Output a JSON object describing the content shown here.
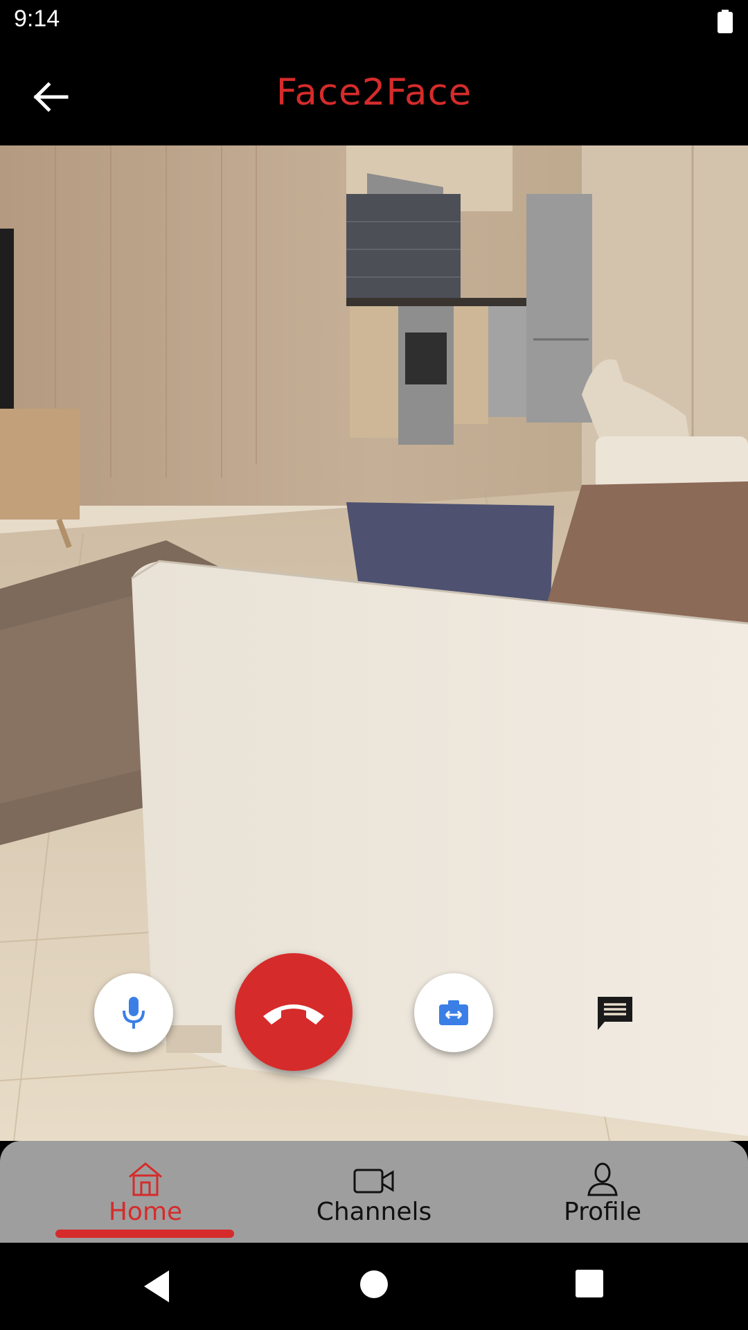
{
  "status_bar": {
    "time": "9:14"
  },
  "app_bar": {
    "title": "Face2Face"
  },
  "call_controls": {
    "mic": "mic-icon",
    "end_call": "call-end-icon",
    "switch_camera": "switch-camera-icon",
    "chat": "chat-icon"
  },
  "bottom_nav": {
    "items": [
      {
        "label": "Home",
        "icon": "home-icon",
        "active": true
      },
      {
        "label": "Channels",
        "icon": "video-camera-icon",
        "active": false
      },
      {
        "label": "Profile",
        "icon": "person-icon",
        "active": false
      }
    ]
  },
  "colors": {
    "accent": "#d62b2b",
    "controls_blue": "#3b7fe6",
    "nav_background": "#9e9e9e",
    "bar_background": "#000000"
  }
}
